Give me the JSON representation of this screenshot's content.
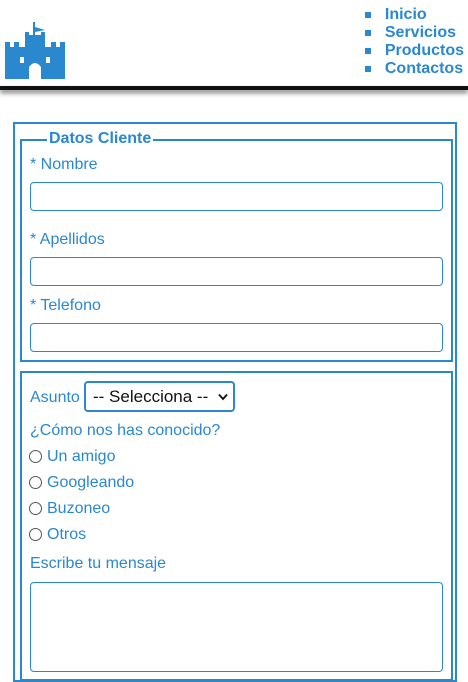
{
  "header": {
    "logo_icon": "castle-icon",
    "brand_color": "#2a88cf",
    "nav": [
      "Inicio",
      "Servicios",
      "Productos",
      "Contactos"
    ]
  },
  "form": {
    "client_legend": "Datos Cliente",
    "nombre_label": "* Nombre",
    "apellidos_label": "* Apellidos",
    "telefono_label": "* Telefono",
    "nombre_value": "",
    "apellidos_value": "",
    "telefono_value": "",
    "asunto_label": "Asunto",
    "asunto_selected": "-- Selecciona --",
    "como_label": "¿Cómo nos has conocido?",
    "options": [
      "Un amigo",
      "Googleando",
      "Buzoneo",
      "Otros"
    ],
    "mensaje_label": "Escribe tu mensaje",
    "mensaje_value": ""
  }
}
